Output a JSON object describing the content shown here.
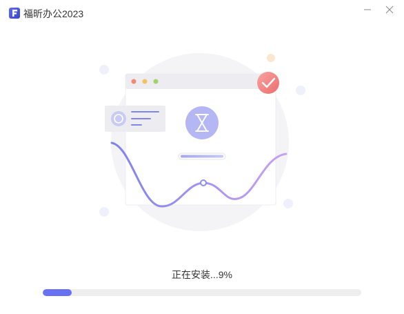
{
  "window": {
    "title": "福昕办公2023"
  },
  "install": {
    "status_text": "正在安装...9%",
    "progress_fraction": 0.09
  },
  "icons": {
    "app_logo": "foxit-logo-icon",
    "minimize": "minimize-icon",
    "close": "close-icon",
    "hourglass": "hourglass-icon",
    "check": "check-icon",
    "refresh": "refresh-icon"
  },
  "colors": {
    "accent": "#6872f0",
    "track": "#eeeeef",
    "check_badge": "#f07a7a"
  }
}
